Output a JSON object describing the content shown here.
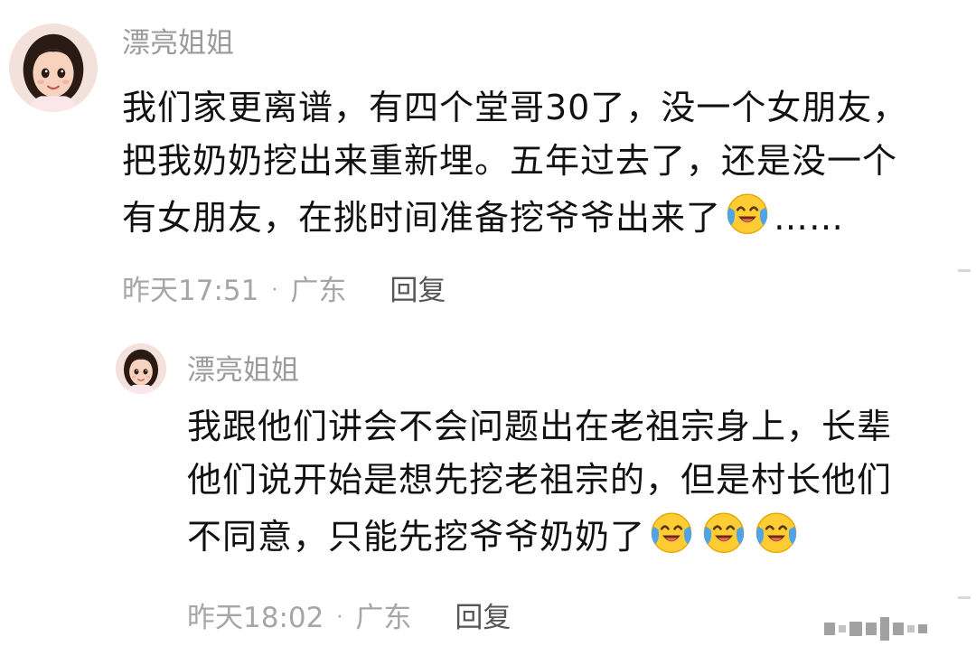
{
  "comment": {
    "username": "漂亮姐姐",
    "lines": [
      "我们家更离谱，有四个堂哥30了，没一个女朋友，",
      "把我奶奶挖出来重新埋。五年过去了，还是没一个",
      "有女朋友，在挑时间准备挖爷爷出来了"
    ],
    "line_suffix": "……",
    "emoji_icon": "crying-laughing-face-icon",
    "time": "昨天17:51",
    "separator": "·",
    "location": "广东",
    "reply_label": "回复"
  },
  "reply": {
    "username": "漂亮姐姐",
    "lines": [
      "我跟他们讲会不会问题出在老祖宗身上，长辈",
      "他们说开始是想先挖老祖宗的，但是村长他们",
      "不同意，只能先挖爷爷奶奶了"
    ],
    "emoji_icon": "crying-laughing-face-icon",
    "emoji_count": 3,
    "time": "昨天18:02",
    "separator": "·",
    "location": "广东",
    "reply_label": "回复"
  },
  "colors": {
    "text": "#111111",
    "username": "#9a9a9a",
    "meta": "#a6a6a6",
    "reply_link": "#555555",
    "emoji_face": "#ffcc33",
    "emoji_tears": "#4fa3e6"
  }
}
